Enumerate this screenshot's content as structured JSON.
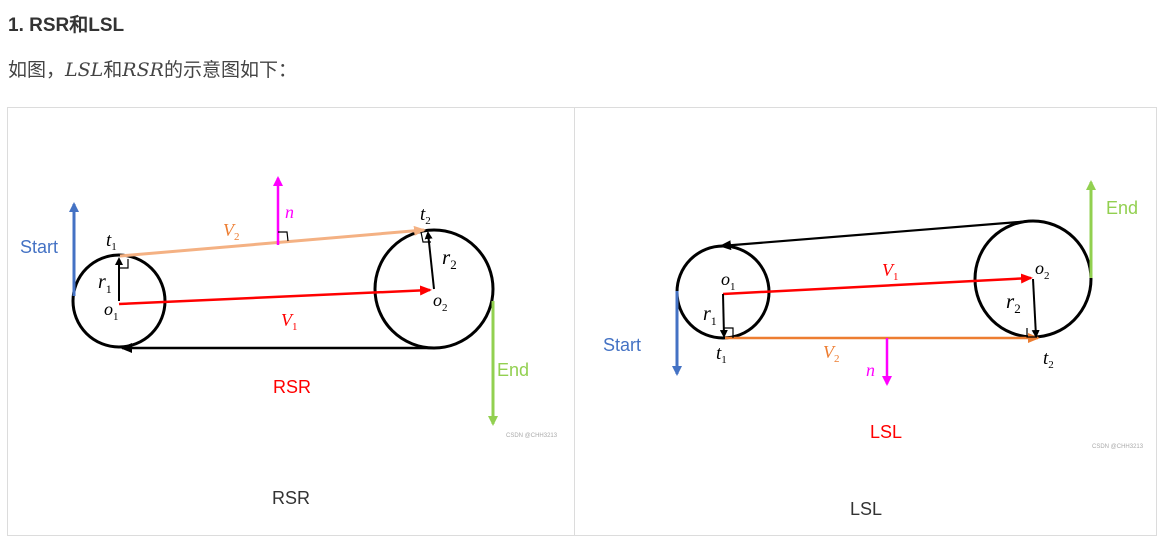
{
  "heading": "1. RSR和LSL",
  "intro": {
    "prefix": "如图，",
    "math1": "LSL",
    "mid": "和",
    "math2": "RSR",
    "suffix": "的示意图如下："
  },
  "colors": {
    "start": "#4472c4",
    "end": "#92d050",
    "v1": "#ff0000",
    "v2": "#f4b183",
    "v2_lsl": "#ed7d31",
    "n": "#ff00ff",
    "black": "#000000"
  },
  "rsr": {
    "start_label": "Start",
    "end_label": "End",
    "title": "RSR",
    "caption": "RSR",
    "labels": {
      "t": "t",
      "t1_sub": "1",
      "t2_sub": "2",
      "r": "r",
      "r1_sub": "1",
      "r2_sub": "2",
      "o": "o",
      "o1_sub": "1",
      "o2_sub": "2",
      "v": "V",
      "v1_sub": "1",
      "v2_sub": "2",
      "n": "n"
    },
    "watermark": "CSDN @CHH3213"
  },
  "lsl": {
    "start_label": "Start",
    "end_label": "End",
    "title": "LSL",
    "caption": "LSL",
    "labels": {
      "t": "t",
      "t1_sub": "1",
      "t2_sub": "2",
      "r": "r",
      "r1_sub": "1",
      "r2_sub": "2",
      "o": "o",
      "o1_sub": "1",
      "o2_sub": "2",
      "v": "V",
      "v1_sub": "1",
      "v2_sub": "2",
      "n": "n"
    },
    "watermark": "CSDN @CHH3213"
  }
}
